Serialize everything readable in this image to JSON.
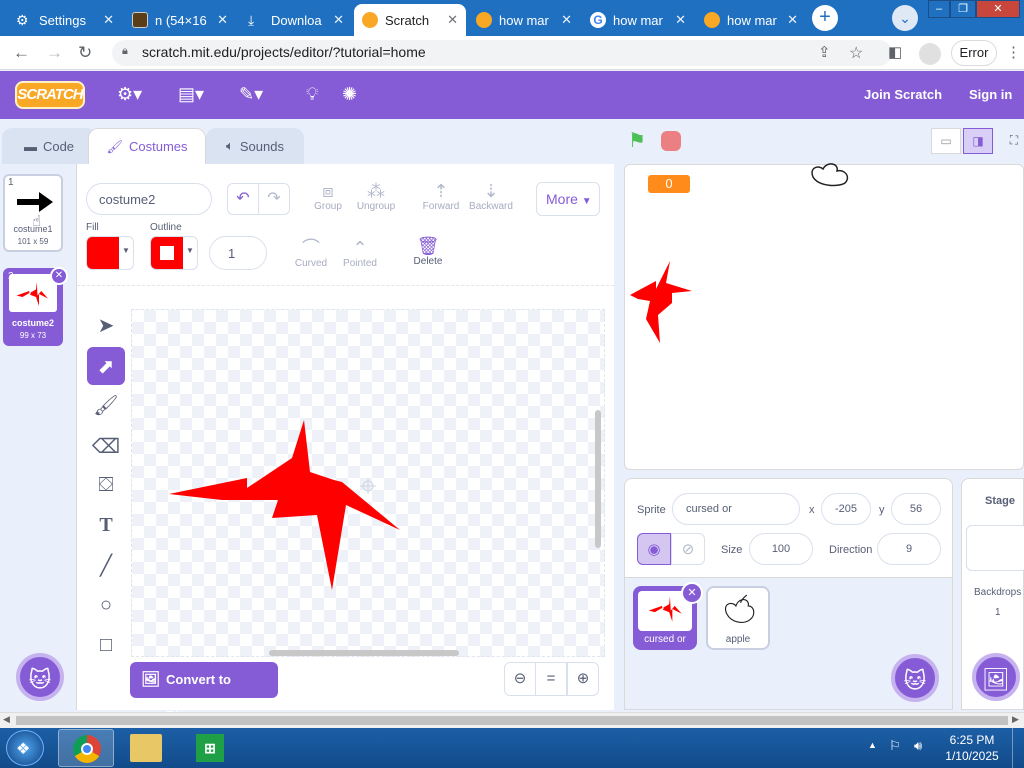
{
  "browser": {
    "tabs": [
      {
        "title": "Settings",
        "favicon_color": "#ffffff"
      },
      {
        "title": "n (54×16",
        "favicon_color": "#5a3e1a"
      },
      {
        "title": "Downloa",
        "favicon_color": "#ffffff"
      },
      {
        "title": "Scratch",
        "favicon_color": "#f9a825"
      },
      {
        "title": "how mar",
        "favicon_color": "#f9a825"
      },
      {
        "title": "how mar",
        "favicon_color": "#ffffff"
      },
      {
        "title": "how mar",
        "favicon_color": "#f9a825"
      }
    ],
    "url": "scratch.mit.edu/projects/editor/?tutorial=home",
    "error_button": "Error"
  },
  "scratch": {
    "logo": "SCRATCH",
    "join": "Join Scratch",
    "signin": "Sign in",
    "tabs": {
      "code": "Code",
      "costumes": "Costumes",
      "sounds": "Sounds"
    },
    "costumes": [
      {
        "num": "1",
        "name": "costume1",
        "size": "101 x 59"
      },
      {
        "num": "2",
        "name": "costume2",
        "size": "99 x 73"
      }
    ],
    "editor": {
      "costume_name": "costume2",
      "group": "Group",
      "ungroup": "Ungroup",
      "forward": "Forward",
      "backward": "Backward",
      "more": "More",
      "fill_label": "Fill",
      "outline_label": "Outline",
      "fill_color": "#ff0000",
      "outline_color": "#ff0000",
      "outline_width": "1",
      "curved": "Curved",
      "pointed": "Pointed",
      "delete": "Delete",
      "convert": "Convert to Bitmap"
    },
    "stage": {
      "score": "0"
    },
    "sprite": {
      "label": "Sprite",
      "name": "cursed or",
      "x_label": "x",
      "x": "-205",
      "y_label": "y",
      "y": "56",
      "size_label": "Size",
      "size": "100",
      "direction_label": "Direction",
      "direction": "9"
    },
    "sprites": [
      {
        "name": "cursed or"
      },
      {
        "name": "apple"
      }
    ],
    "stage_pane": {
      "title": "Stage",
      "backdrops_label": "Backdrops",
      "backdrops_count": "1"
    }
  },
  "taskbar": {
    "time": "6:25 PM",
    "date": "1/10/2025"
  }
}
